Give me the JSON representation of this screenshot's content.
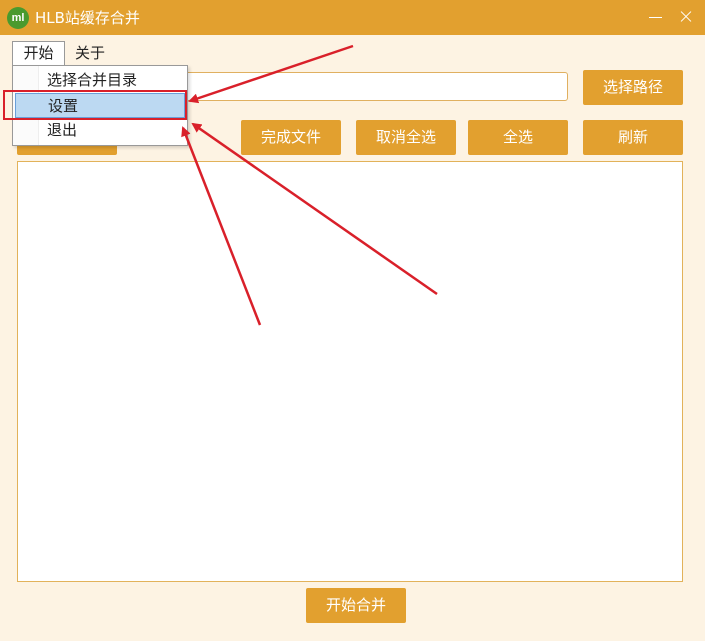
{
  "window": {
    "icon_text": "ml",
    "title": "HLB站缓存合并"
  },
  "menubar": {
    "start": "开始",
    "about": "关于"
  },
  "dropdown": {
    "items": [
      {
        "label": "选择合并目录"
      },
      {
        "label": "设置"
      },
      {
        "label": "退出"
      }
    ]
  },
  "path": {
    "value": ""
  },
  "toolbar": {
    "select_path": "选择路径",
    "complete_files": "完成文件",
    "cancel_select_all": "取消全选",
    "select_all": "全选",
    "refresh": "刷新"
  },
  "footer": {
    "start_merge": "开始合并"
  },
  "colors": {
    "accent": "#e2a02f",
    "annotation": "#d9202a"
  }
}
